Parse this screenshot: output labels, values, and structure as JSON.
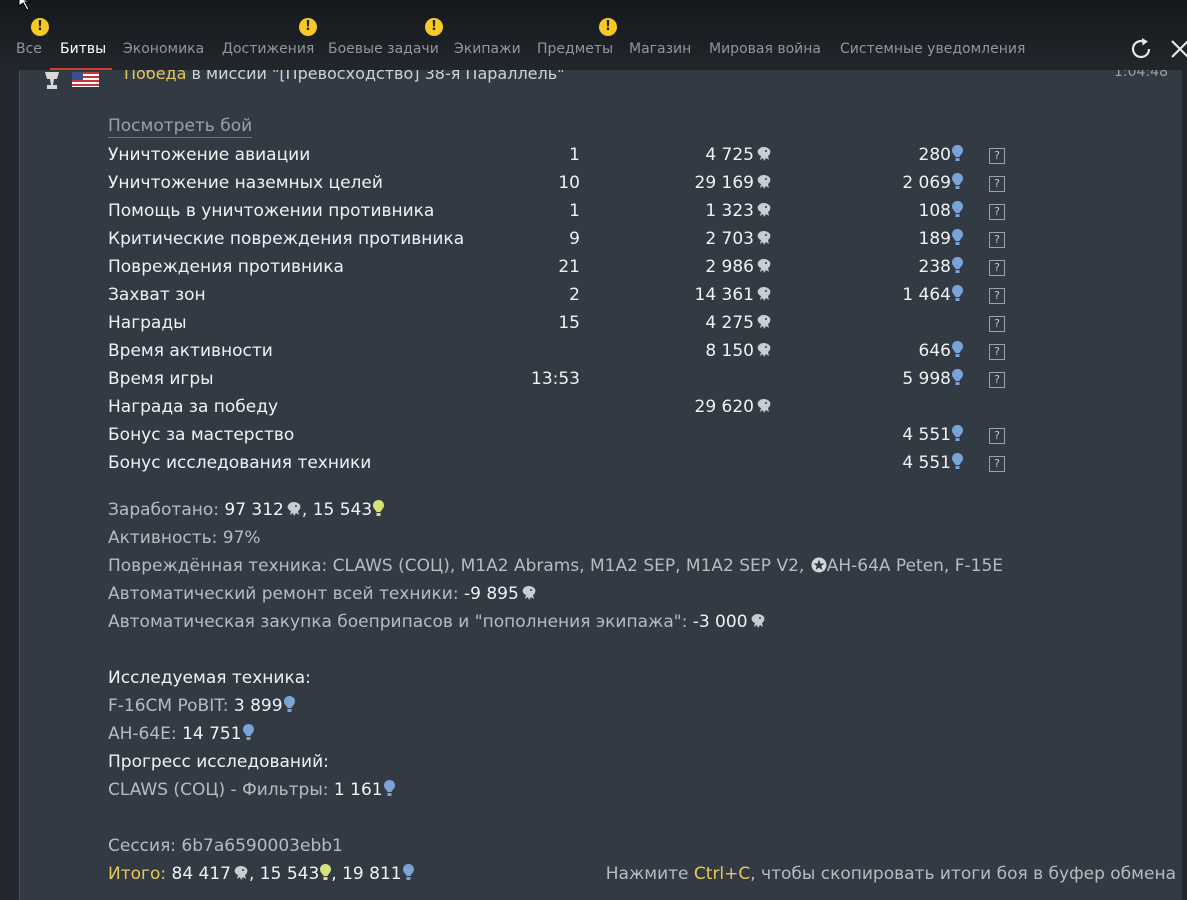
{
  "tabs": [
    {
      "label": "Все"
    },
    {
      "label": "Битвы"
    },
    {
      "label": "Экономика"
    },
    {
      "label": "Достижения"
    },
    {
      "label": "Боевые задачи"
    },
    {
      "label": "Экипажи"
    },
    {
      "label": "Предметы"
    },
    {
      "label": "Магазин"
    },
    {
      "label": "Мировая война"
    },
    {
      "label": "Системные уведомления"
    }
  ],
  "warning_badge": "!",
  "header": {
    "result": "Победа",
    "text": " в миссии \"[Превосходство] 38-я Параллель\"",
    "time": "1:04:48"
  },
  "watch_link": "Посмотреть бой",
  "rows": [
    {
      "label": "Уничтожение авиации",
      "count": "1",
      "lions": "4 725",
      "rp": "280",
      "help": "?"
    },
    {
      "label": "Уничтожение наземных целей",
      "count": "10",
      "lions": "29 169",
      "rp": "2 069",
      "help": "?"
    },
    {
      "label": "Помощь в уничтожении противника",
      "count": "1",
      "lions": "1 323",
      "rp": "108",
      "help": "?"
    },
    {
      "label": "Критические повреждения противника",
      "count": "9",
      "lions": "2 703",
      "rp": "189",
      "help": "?"
    },
    {
      "label": "Повреждения противника",
      "count": "21",
      "lions": "2 986",
      "rp": "238",
      "help": "?"
    },
    {
      "label": "Захват зон",
      "count": "2",
      "lions": "14 361",
      "rp": "1 464",
      "help": "?"
    },
    {
      "label": "Награды",
      "count": "15",
      "lions": "4 275",
      "rp": "",
      "help": "?"
    },
    {
      "label": "Время активности",
      "count": "",
      "lions": "8 150",
      "rp": "646",
      "help": "?"
    },
    {
      "label": "Время игры",
      "count": "13:53",
      "lions": "",
      "rp": "5 998",
      "help": "?"
    },
    {
      "label": "Награда за победу",
      "count": "",
      "lions": "29 620",
      "rp": "",
      "help": ""
    },
    {
      "label": "Бонус за мастерство",
      "count": "",
      "lions": "",
      "rp": "4 551",
      "help": "?"
    },
    {
      "label": "Бонус исследования техники",
      "count": "",
      "lions": "",
      "rp": "4 551",
      "help": "?"
    }
  ],
  "summary": {
    "earned_label": "Заработано: ",
    "earned_lions": "97 312",
    "earned_sep": ", ",
    "earned_frp": "15 543",
    "activity_label": "Активность: ",
    "activity_value": "97%",
    "damaged_label": "Повреждённая техника: ",
    "damaged_a": "CLAWS (СОЦ), M1A2 Abrams, M1A2 SEP, M1A2 SEP V2, ",
    "damaged_b": "AH-64A Peten, F-15E",
    "repair_label": "Автоматический ремонт всей техники: ",
    "repair_value": "-9 895",
    "ammo_label": "Автоматическая закупка боеприпасов и \"пополнения экипажа\": ",
    "ammo_value": "-3 000"
  },
  "research": {
    "title": "Исследуемая техника:",
    "items": [
      {
        "name": "F-16CM PoBIT: ",
        "value": "3 899"
      },
      {
        "name": "AH-64E: ",
        "value": "14 751"
      }
    ],
    "progress_title": "Прогресс исследований:",
    "progress_name": "CLAWS (СОЦ) - Фильтры: ",
    "progress_value": "1 161"
  },
  "session": "Сессия: 6b7a6590003ebb1",
  "total": {
    "label": "Итого:",
    "lions": "84 417",
    "frp": "15 543",
    "rp": "19 811",
    "sep": ", "
  },
  "copy_hint": {
    "pre": "Нажмите ",
    "key": "Ctrl+C",
    "post": ", чтобы скопировать итоги боя в буфер обмена"
  },
  "colors": {
    "accent": "#d0402c",
    "warning": "#f5c928",
    "rp": "#7aa3d8",
    "free_rp": "#d8e27a",
    "highlight": "#e9c85a"
  },
  "icons": {
    "lions": "lion-icon",
    "rp": "research-points-icon",
    "free_rp": "free-research-points-icon"
  }
}
